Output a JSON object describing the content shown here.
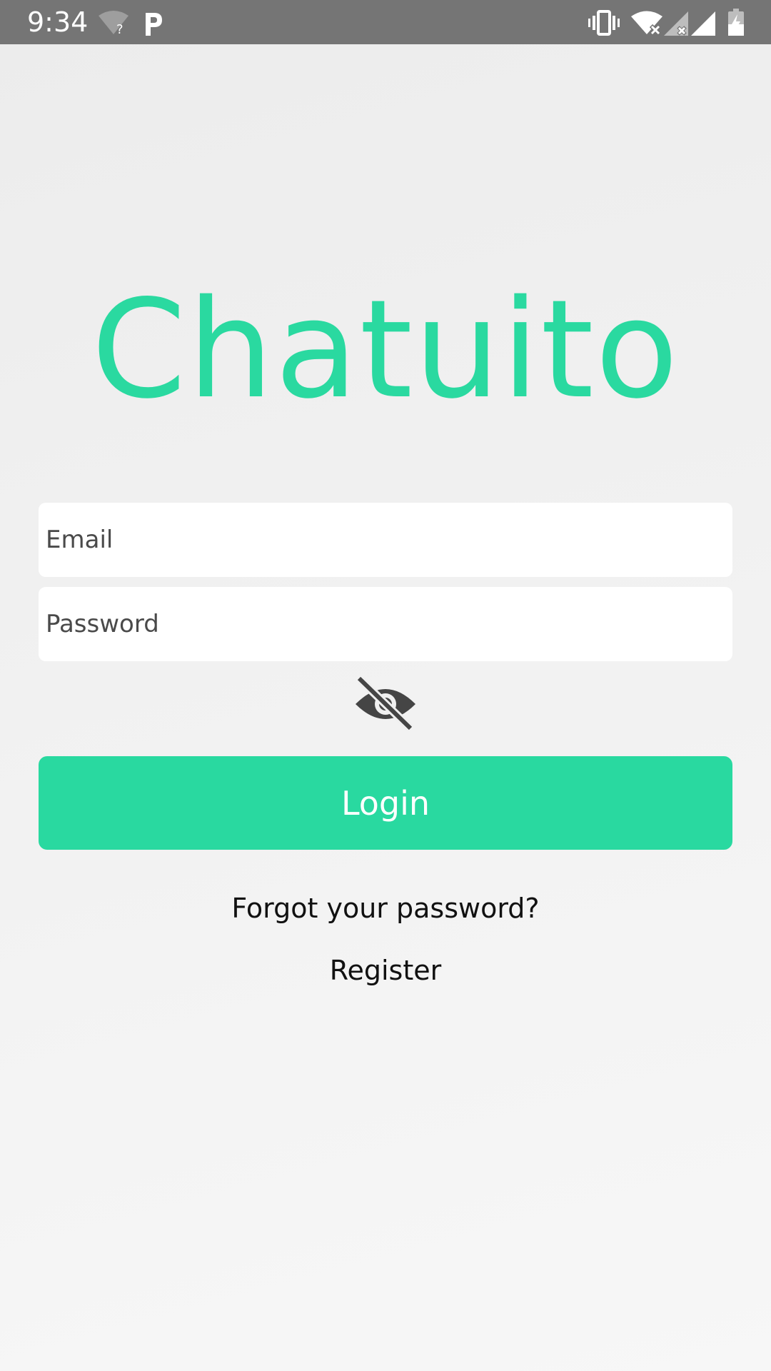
{
  "status_bar": {
    "time": "9:34",
    "icons": [
      "wifi-question-icon",
      "parking-icon",
      "vibrate-icon",
      "wifi-off-icon",
      "signal-off-icon",
      "signal-icon",
      "battery-charging-icon"
    ]
  },
  "app": {
    "title": "Chatuito",
    "accent_color": "#2ad9a0"
  },
  "form": {
    "email_placeholder": "Email",
    "email_value": "",
    "password_placeholder": "Password",
    "password_value": "",
    "toggle_icon": "eye-off-icon",
    "login_label": "Login",
    "forgot_label": "Forgot your password?",
    "register_label": "Register"
  }
}
